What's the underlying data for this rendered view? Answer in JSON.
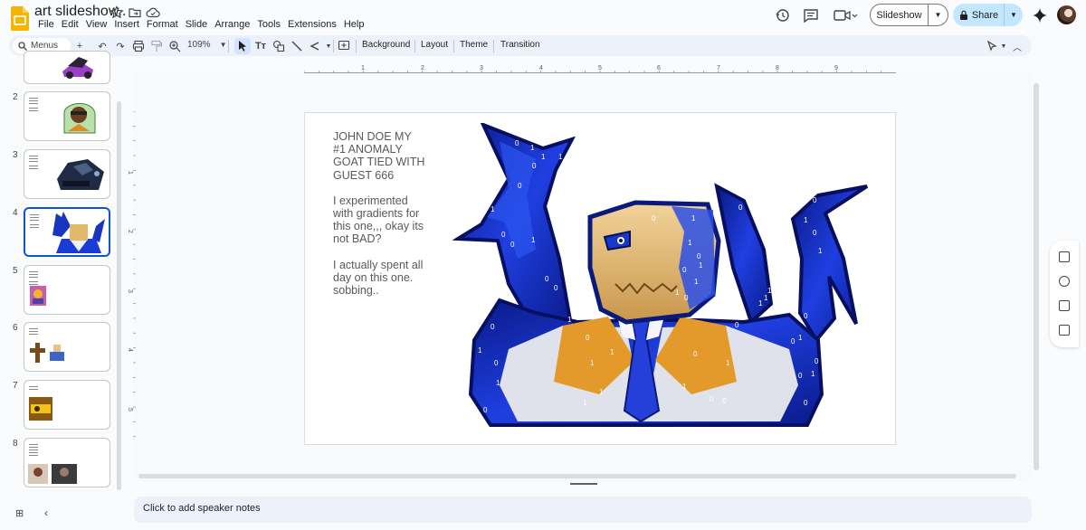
{
  "app": {
    "doc_title": "art slideshow..",
    "menus": [
      "File",
      "Edit",
      "View",
      "Insert",
      "Format",
      "Slide",
      "Arrange",
      "Tools",
      "Extensions",
      "Help"
    ],
    "slideshow_label": "Slideshow",
    "share_label": "Share",
    "accent": "#0b57d0",
    "share_bg": "#c2e7ff"
  },
  "toolbar": {
    "search_placeholder": "Menus",
    "zoom": "109%",
    "background_label": "Background",
    "layout_label": "Layout",
    "theme_label": "Theme",
    "transition_label": "Transition"
  },
  "filmstrip": {
    "slides": [
      {
        "num": "",
        "kind": "car-partial"
      },
      {
        "num": "2",
        "kind": "portrait-green"
      },
      {
        "num": "3",
        "kind": "dark-vehicle"
      },
      {
        "num": "4",
        "kind": "blue-figure",
        "selected": true
      },
      {
        "num": "5",
        "kind": "small-colorful"
      },
      {
        "num": "6",
        "kind": "cross-figures"
      },
      {
        "num": "7",
        "kind": "yellow-scene"
      },
      {
        "num": "8",
        "kind": "two-images"
      }
    ]
  },
  "ruler": {
    "h_marks": [
      "1",
      "2",
      "3",
      "4",
      "5",
      "6",
      "7",
      "8",
      "9"
    ],
    "v_marks": [
      "1",
      "2",
      "3",
      "4",
      "5"
    ]
  },
  "slide": {
    "title_line_1": "JOHN DOE MY",
    "title_line_2": "#1 ANOMALY",
    "title_line_3": "GOAT TIED WITH",
    "title_line_4": "GUEST 666",
    "para_1_line_1": "I experimented",
    "para_1_line_2": "with gradients for",
    "para_1_line_3": "this one,,, okay its",
    "para_1_line_4": "not BAD?",
    "para_2_line_1": "I actually spent all",
    "para_2_line_2": "day on this one.",
    "para_2_line_3": "sobbing.."
  },
  "notes": {
    "placeholder": "Click to add speaker notes"
  }
}
